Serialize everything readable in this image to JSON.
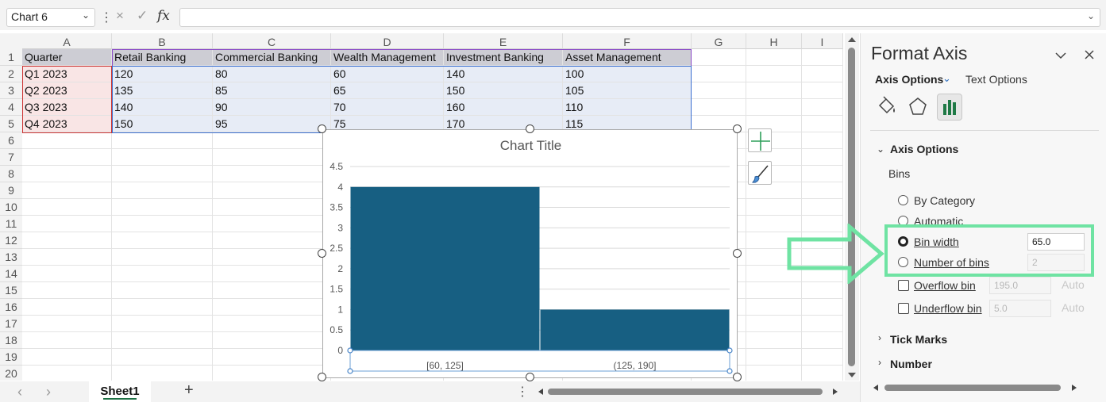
{
  "formula_bar": {
    "name_box": "Chart 6",
    "cancel_icon": "×",
    "enter_icon": "✓",
    "fx_label": "fx",
    "formula": ""
  },
  "sheet": {
    "columns": [
      "A",
      "B",
      "C",
      "D",
      "E",
      "F",
      "G",
      "H",
      "I"
    ],
    "rows": [
      "1",
      "2",
      "3",
      "4",
      "5",
      "6",
      "7",
      "8",
      "9",
      "10",
      "11",
      "12",
      "13",
      "14",
      "15",
      "16",
      "17",
      "18",
      "19",
      "20"
    ],
    "cells": [
      [
        "Quarter",
        "Retail Banking",
        "Commercial Banking",
        "Wealth Management",
        "Investment Banking",
        "Asset Management"
      ],
      [
        "Q1 2023",
        "120",
        "80",
        "60",
        "140",
        "100"
      ],
      [
        "Q2 2023",
        "135",
        "85",
        "65",
        "150",
        "105"
      ],
      [
        "Q3 2023",
        "140",
        "90",
        "70",
        "160",
        "110"
      ],
      [
        "Q4 2023",
        "150",
        "95",
        "75",
        "170",
        "115"
      ]
    ],
    "tab_label": "Sheet1",
    "add_sheet_label": "+"
  },
  "chart_data": {
    "type": "bar",
    "title": "Chart Title",
    "categories": [
      "[60, 125]",
      "(125, 190]"
    ],
    "values": [
      4,
      1
    ],
    "y_ticks": [
      "0",
      "0.5",
      "1",
      "1.5",
      "2",
      "2.5",
      "3",
      "3.5",
      "4",
      "4.5"
    ],
    "ylim": [
      0,
      4.5
    ],
    "bar_color": "#175f82",
    "grid": true
  },
  "format_pane": {
    "title": "Format Axis",
    "tab_axis_options": "Axis Options",
    "tab_text_options": "Text Options",
    "section_axis_options": "Axis Options",
    "bins_label": "Bins",
    "by_category": "By Category",
    "automatic": "Automatic",
    "bin_width": "Bin width",
    "bin_width_value": "65.0",
    "number_of_bins": "Number of bins",
    "number_of_bins_value": "2",
    "overflow_bin": "Overflow bin",
    "overflow_value": "195.0",
    "underflow_bin": "Underflow bin",
    "underflow_value": "5.0",
    "auto_label": "Auto",
    "tick_marks": "Tick Marks",
    "number": "Number",
    "selected_bin_option": "Bin width"
  },
  "annotation": {
    "color": "#6fe3a3"
  }
}
